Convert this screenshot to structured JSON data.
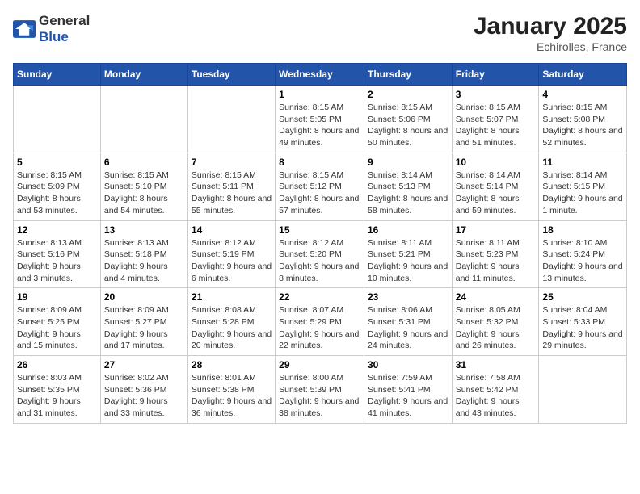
{
  "header": {
    "logo_general": "General",
    "logo_blue": "Blue",
    "title": "January 2025",
    "subtitle": "Echirolles, France"
  },
  "days_of_week": [
    "Sunday",
    "Monday",
    "Tuesday",
    "Wednesday",
    "Thursday",
    "Friday",
    "Saturday"
  ],
  "weeks": [
    [
      {
        "day": "",
        "detail": ""
      },
      {
        "day": "",
        "detail": ""
      },
      {
        "day": "",
        "detail": ""
      },
      {
        "day": "1",
        "detail": "Sunrise: 8:15 AM\nSunset: 5:05 PM\nDaylight: 8 hours and 49 minutes."
      },
      {
        "day": "2",
        "detail": "Sunrise: 8:15 AM\nSunset: 5:06 PM\nDaylight: 8 hours and 50 minutes."
      },
      {
        "day": "3",
        "detail": "Sunrise: 8:15 AM\nSunset: 5:07 PM\nDaylight: 8 hours and 51 minutes."
      },
      {
        "day": "4",
        "detail": "Sunrise: 8:15 AM\nSunset: 5:08 PM\nDaylight: 8 hours and 52 minutes."
      }
    ],
    [
      {
        "day": "5",
        "detail": "Sunrise: 8:15 AM\nSunset: 5:09 PM\nDaylight: 8 hours and 53 minutes."
      },
      {
        "day": "6",
        "detail": "Sunrise: 8:15 AM\nSunset: 5:10 PM\nDaylight: 8 hours and 54 minutes."
      },
      {
        "day": "7",
        "detail": "Sunrise: 8:15 AM\nSunset: 5:11 PM\nDaylight: 8 hours and 55 minutes."
      },
      {
        "day": "8",
        "detail": "Sunrise: 8:15 AM\nSunset: 5:12 PM\nDaylight: 8 hours and 57 minutes."
      },
      {
        "day": "9",
        "detail": "Sunrise: 8:14 AM\nSunset: 5:13 PM\nDaylight: 8 hours and 58 minutes."
      },
      {
        "day": "10",
        "detail": "Sunrise: 8:14 AM\nSunset: 5:14 PM\nDaylight: 8 hours and 59 minutes."
      },
      {
        "day": "11",
        "detail": "Sunrise: 8:14 AM\nSunset: 5:15 PM\nDaylight: 9 hours and 1 minute."
      }
    ],
    [
      {
        "day": "12",
        "detail": "Sunrise: 8:13 AM\nSunset: 5:16 PM\nDaylight: 9 hours and 3 minutes."
      },
      {
        "day": "13",
        "detail": "Sunrise: 8:13 AM\nSunset: 5:18 PM\nDaylight: 9 hours and 4 minutes."
      },
      {
        "day": "14",
        "detail": "Sunrise: 8:12 AM\nSunset: 5:19 PM\nDaylight: 9 hours and 6 minutes."
      },
      {
        "day": "15",
        "detail": "Sunrise: 8:12 AM\nSunset: 5:20 PM\nDaylight: 9 hours and 8 minutes."
      },
      {
        "day": "16",
        "detail": "Sunrise: 8:11 AM\nSunset: 5:21 PM\nDaylight: 9 hours and 10 minutes."
      },
      {
        "day": "17",
        "detail": "Sunrise: 8:11 AM\nSunset: 5:23 PM\nDaylight: 9 hours and 11 minutes."
      },
      {
        "day": "18",
        "detail": "Sunrise: 8:10 AM\nSunset: 5:24 PM\nDaylight: 9 hours and 13 minutes."
      }
    ],
    [
      {
        "day": "19",
        "detail": "Sunrise: 8:09 AM\nSunset: 5:25 PM\nDaylight: 9 hours and 15 minutes."
      },
      {
        "day": "20",
        "detail": "Sunrise: 8:09 AM\nSunset: 5:27 PM\nDaylight: 9 hours and 17 minutes."
      },
      {
        "day": "21",
        "detail": "Sunrise: 8:08 AM\nSunset: 5:28 PM\nDaylight: 9 hours and 20 minutes."
      },
      {
        "day": "22",
        "detail": "Sunrise: 8:07 AM\nSunset: 5:29 PM\nDaylight: 9 hours and 22 minutes."
      },
      {
        "day": "23",
        "detail": "Sunrise: 8:06 AM\nSunset: 5:31 PM\nDaylight: 9 hours and 24 minutes."
      },
      {
        "day": "24",
        "detail": "Sunrise: 8:05 AM\nSunset: 5:32 PM\nDaylight: 9 hours and 26 minutes."
      },
      {
        "day": "25",
        "detail": "Sunrise: 8:04 AM\nSunset: 5:33 PM\nDaylight: 9 hours and 29 minutes."
      }
    ],
    [
      {
        "day": "26",
        "detail": "Sunrise: 8:03 AM\nSunset: 5:35 PM\nDaylight: 9 hours and 31 minutes."
      },
      {
        "day": "27",
        "detail": "Sunrise: 8:02 AM\nSunset: 5:36 PM\nDaylight: 9 hours and 33 minutes."
      },
      {
        "day": "28",
        "detail": "Sunrise: 8:01 AM\nSunset: 5:38 PM\nDaylight: 9 hours and 36 minutes."
      },
      {
        "day": "29",
        "detail": "Sunrise: 8:00 AM\nSunset: 5:39 PM\nDaylight: 9 hours and 38 minutes."
      },
      {
        "day": "30",
        "detail": "Sunrise: 7:59 AM\nSunset: 5:41 PM\nDaylight: 9 hours and 41 minutes."
      },
      {
        "day": "31",
        "detail": "Sunrise: 7:58 AM\nSunset: 5:42 PM\nDaylight: 9 hours and 43 minutes."
      },
      {
        "day": "",
        "detail": ""
      }
    ]
  ]
}
